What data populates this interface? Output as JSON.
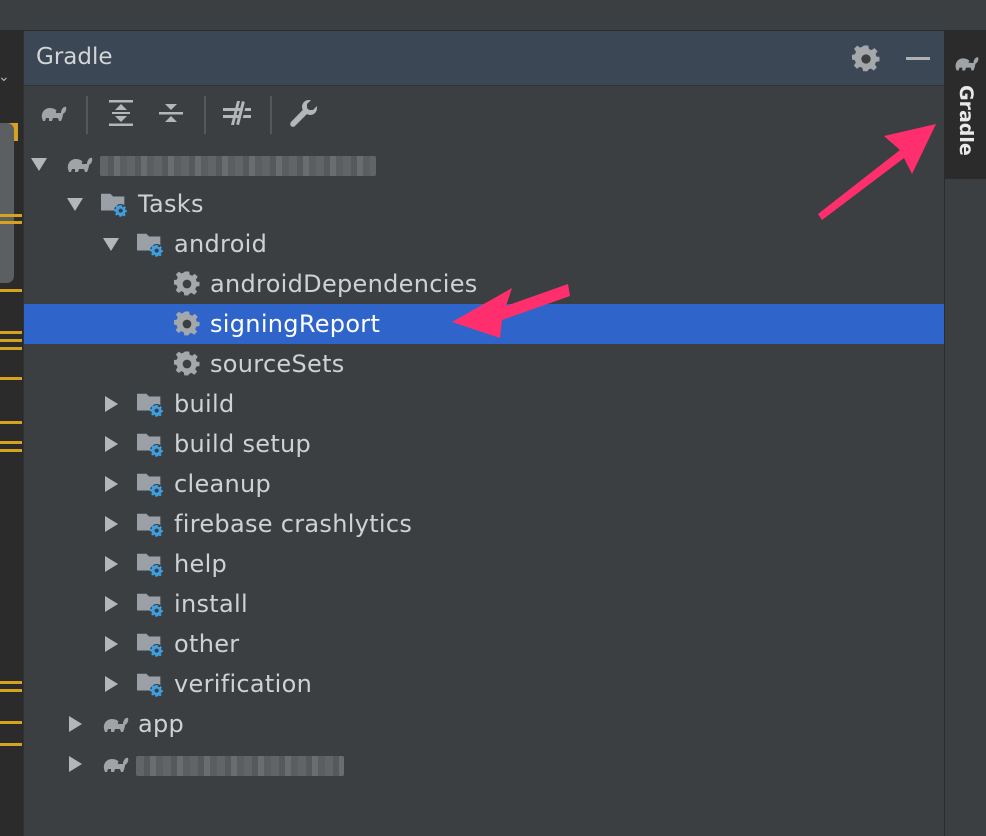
{
  "panel": {
    "title": "Gradle"
  },
  "side_tab": {
    "label": "Gradle"
  },
  "tree": {
    "root": {
      "label": ""
    },
    "tasks": {
      "label": "Tasks"
    },
    "android": {
      "label": "android"
    },
    "android_tasks": [
      {
        "label": "androidDependencies"
      },
      {
        "label": "signingReport",
        "selected": true
      },
      {
        "label": "sourceSets"
      }
    ],
    "groups": [
      {
        "label": "build"
      },
      {
        "label": "build setup"
      },
      {
        "label": "cleanup"
      },
      {
        "label": "firebase crashlytics"
      },
      {
        "label": "help"
      },
      {
        "label": "install"
      },
      {
        "label": "other"
      },
      {
        "label": "verification"
      }
    ],
    "modules": [
      {
        "label": "app"
      },
      {
        "label": ""
      }
    ]
  },
  "colors": {
    "selection": "#2f65ca",
    "annotation_arrow": "#ff2f6d",
    "gear_badge": "#3d9fe0"
  },
  "icons": {
    "toolbar": [
      "elephant-icon",
      "expand-all-icon",
      "collapse-all-icon",
      "toggle-offline-icon",
      "wrench-icon"
    ],
    "header": [
      "gear-icon",
      "minimize-icon"
    ]
  }
}
